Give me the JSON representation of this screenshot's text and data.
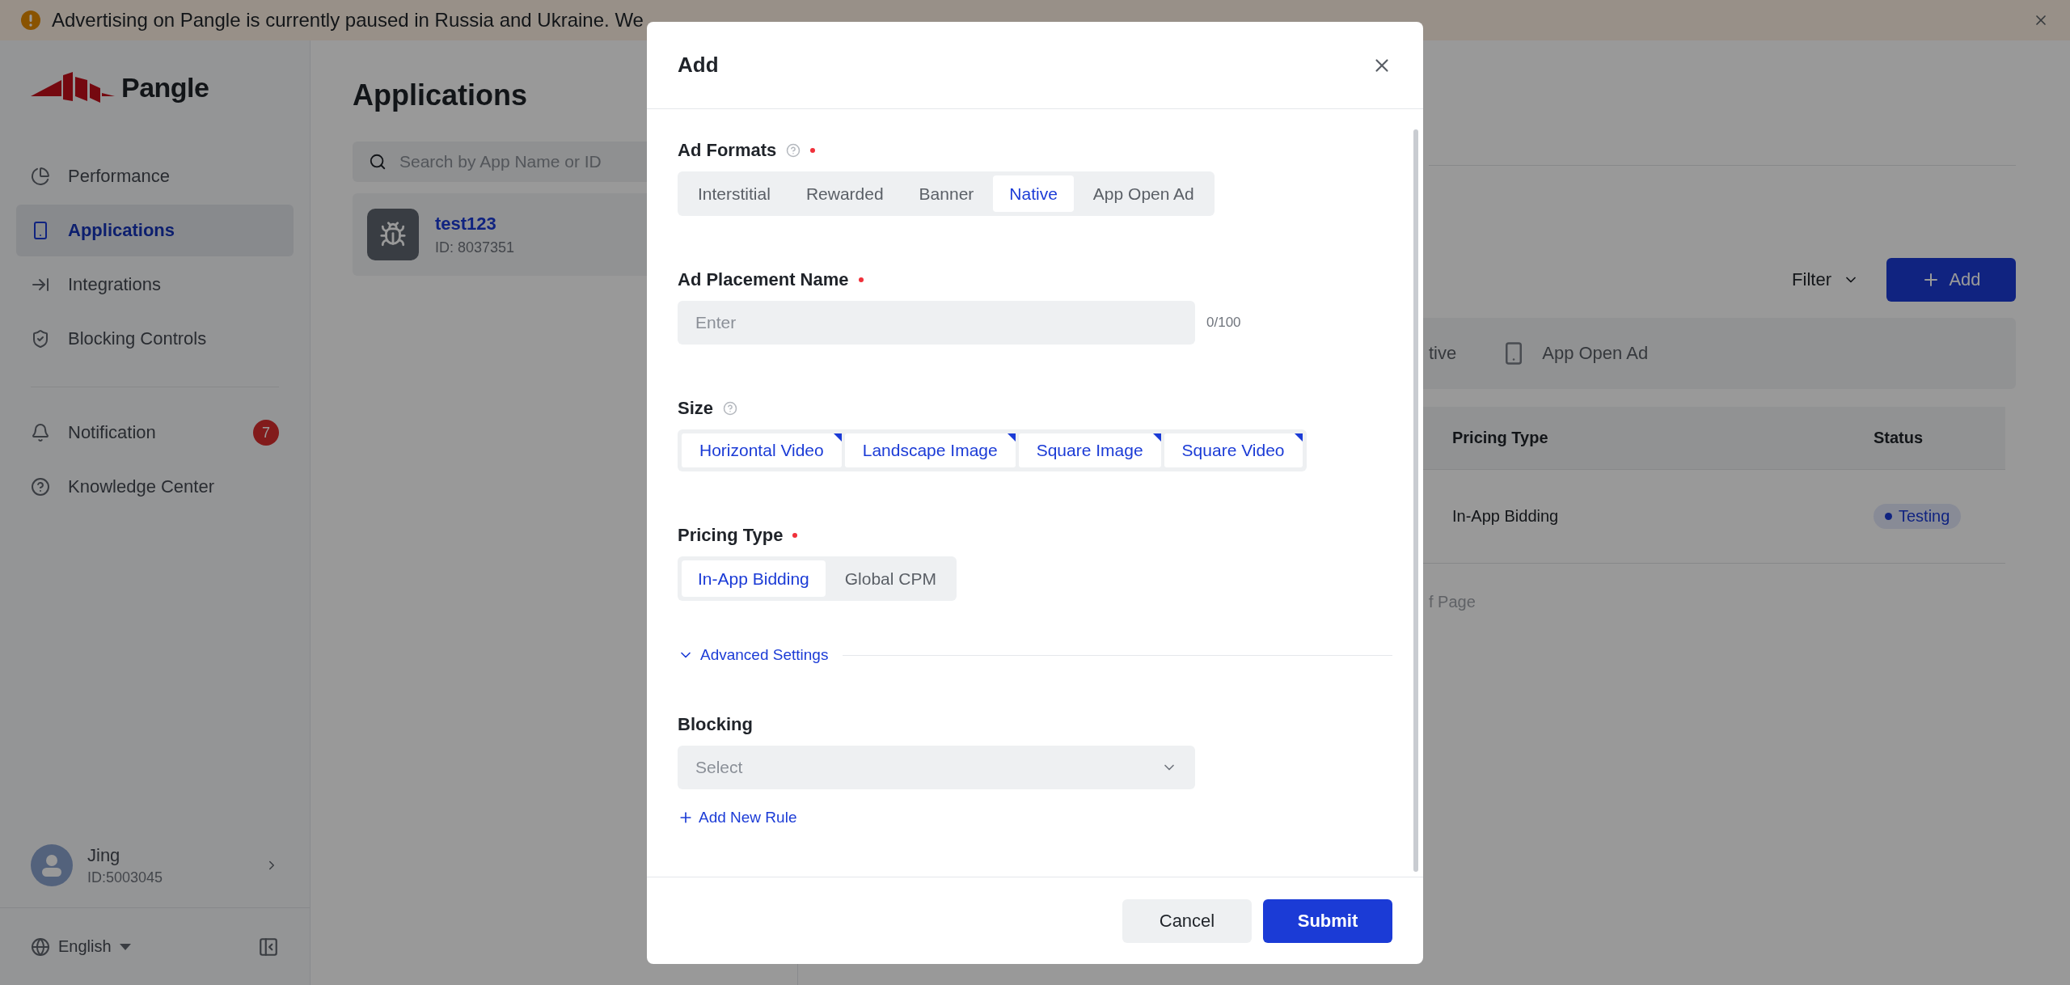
{
  "banner": {
    "text": "Advertising on Pangle is currently paused in Russia and Ukraine. We"
  },
  "sidebar": {
    "logo": "Pangle",
    "nav": [
      {
        "label": "Performance",
        "selected": false
      },
      {
        "label": "Applications",
        "selected": true
      },
      {
        "label": "Integrations",
        "selected": false
      },
      {
        "label": "Blocking Controls",
        "selected": false
      }
    ],
    "secondary_nav": [
      {
        "label": "Notification",
        "badge": "7"
      },
      {
        "label": "Knowledge Center"
      }
    ],
    "user": {
      "name": "Jing",
      "id": "ID:5003045"
    },
    "language": "English"
  },
  "app_list": {
    "title": "Applications",
    "search": {
      "placeholder": "Search by App Name or ID"
    },
    "apps": [
      {
        "name": "test123",
        "id": "ID: 8037351"
      }
    ]
  },
  "detail": {
    "filter": "Filter",
    "add_button": "Add",
    "tabs": [
      {
        "label": "tive"
      },
      {
        "label": "App Open Ad"
      }
    ],
    "table": {
      "columns": [
        "Pricing Type",
        "Status"
      ],
      "rows": [
        {
          "pricing_type": "In-App Bidding",
          "status": "Testing"
        }
      ]
    },
    "pagination": "f Page"
  },
  "modal": {
    "title": "Add",
    "ad_formats": {
      "label": "Ad Formats",
      "required": true,
      "help": true,
      "options": [
        {
          "label": "Interstitial",
          "selected": false
        },
        {
          "label": "Rewarded",
          "selected": false
        },
        {
          "label": "Banner",
          "selected": false
        },
        {
          "label": "Native",
          "selected": true
        },
        {
          "label": "App Open Ad",
          "selected": false
        }
      ]
    },
    "placement_name": {
      "label": "Ad Placement Name",
      "required": true,
      "placeholder": "Enter",
      "counter": "0/100"
    },
    "size": {
      "label": "Size",
      "help": true,
      "options": [
        {
          "label": "Horizontal Video",
          "selected": true
        },
        {
          "label": "Landscape Image",
          "selected": true
        },
        {
          "label": "Square Image",
          "selected": true
        },
        {
          "label": "Square Video",
          "selected": true
        }
      ]
    },
    "pricing_type": {
      "label": "Pricing Type",
      "required": true,
      "options": [
        {
          "label": "In-App Bidding",
          "selected": true
        },
        {
          "label": "Global CPM",
          "selected": false
        }
      ]
    },
    "advanced_settings": {
      "label": "Advanced Settings",
      "expanded": true
    },
    "blocking": {
      "label": "Blocking",
      "placeholder": "Select"
    },
    "add_rule": "Add New Rule",
    "buttons": [
      {
        "label": "Cancel",
        "kind": "secondary"
      },
      {
        "label": "Submit",
        "kind": "primary"
      }
    ]
  }
}
